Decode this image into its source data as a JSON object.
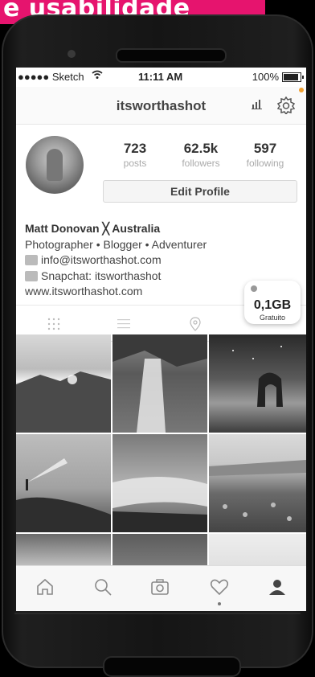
{
  "banner": {
    "text": "e usabilidade"
  },
  "status_bar": {
    "carrier": "●●●●● Sketch",
    "time": "11:11 AM",
    "battery": "100%"
  },
  "profile": {
    "username": "itsworthashot",
    "stats": [
      {
        "value": "723",
        "label": "posts"
      },
      {
        "value": "62.5k",
        "label": "followers"
      },
      {
        "value": "597",
        "label": "following"
      }
    ],
    "edit_button": "Edit Profile",
    "name_line": "Matt Donovan ╳ Australia",
    "bio_line": "Photographer • Blogger • Adventurer",
    "email": "info@itsworthashot.com",
    "snapchat": "Snapchat: itsworthashot",
    "website": "www.itsworthashot.com"
  },
  "storage_badge": {
    "value": "0,1GB",
    "label": "Gratuito"
  },
  "tabs": [
    "grid-icon",
    "list-icon",
    "location-pin-icon"
  ],
  "photos": [
    "mountain-sunset",
    "waterfall-forest",
    "sea-arch-night",
    "hiker-headlamp",
    "waterfall-cascade",
    "coastal-flowers",
    "waterfall-small",
    "rocky-coast",
    "beach-mist"
  ],
  "bottom_tabs": [
    "home-icon",
    "search-icon",
    "camera-icon",
    "heart-icon",
    "profile-icon"
  ],
  "colors": {
    "accent": "#e6146e",
    "screen_bg": "#ffffff"
  }
}
